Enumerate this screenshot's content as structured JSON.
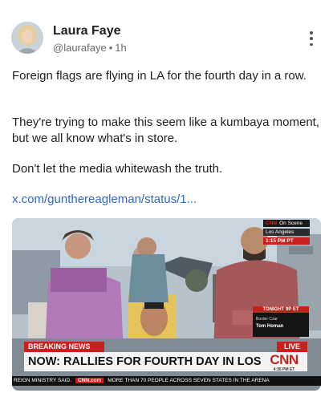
{
  "post": {
    "author_name": "Laura Faye",
    "handle": "@laurafaye",
    "separator": "•",
    "age": "1h",
    "more_icon": "more-vertical-icon",
    "paragraphs": [
      "Foreign flags are flying in LA for the fourth day in a row.",
      "They're trying to make this seem like a kumbaya moment, but we all know what's in store.",
      "Don't let the media whitewash the truth."
    ],
    "link_text": "x.com/gunthereagleman/status/1..."
  },
  "video": {
    "cnn_on_scene": "On Scene",
    "cnn_badge": "CNN",
    "location": "Los Angeles",
    "time": "1:15 PM PT",
    "teaser_label": "TONIGHT 9P ET",
    "teaser_sub": "Border Czar",
    "teaser_name": "Tom Homan",
    "breaking": "BREAKING NEWS",
    "live": "LIVE",
    "headline": "NOW: RALLIES FOR FOURTH DAY IN LOS ANGELES",
    "logo": "CNN",
    "logo_time": "4:35 PM ET",
    "ticker_left": "REIGN MINISTRY SAID.",
    "ticker_brand": "CNN.com",
    "ticker_right": "MORE THAN 70 PEOPLE ACROSS SEVEN STATES IN THE ARENA",
    "colors": {
      "cnn_red": "#c8201c",
      "link": "#2f67c6"
    }
  }
}
